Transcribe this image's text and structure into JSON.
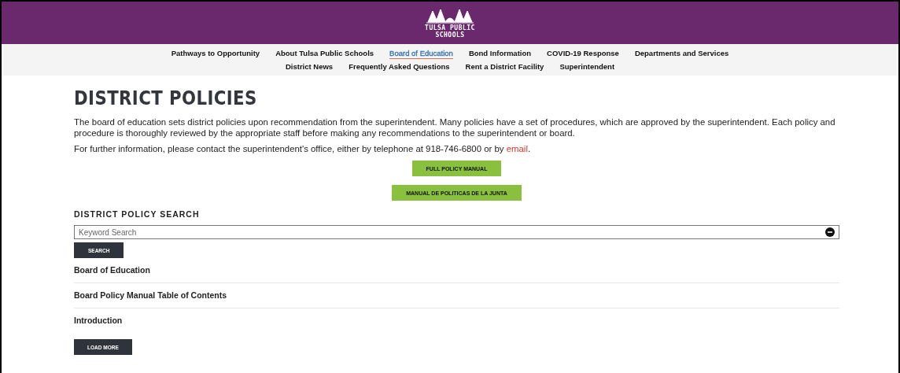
{
  "header": {
    "logo_lines": [
      "TULSA PUBLIC",
      "SCHOOLS"
    ]
  },
  "nav": {
    "items": [
      {
        "label": "Pathways to Opportunity",
        "selected": false
      },
      {
        "label": "About Tulsa Public Schools",
        "selected": false
      },
      {
        "label": "Board of Education",
        "selected": true
      },
      {
        "label": "Bond Information",
        "selected": false
      },
      {
        "label": "COVID-19 Response",
        "selected": false
      },
      {
        "label": "Departments and Services",
        "selected": false
      },
      {
        "label": "District News",
        "selected": false
      },
      {
        "label": "Frequently Asked Questions",
        "selected": false
      },
      {
        "label": "Rent a District Facility",
        "selected": false
      },
      {
        "label": "Superintendent",
        "selected": false
      }
    ]
  },
  "page_title": "DISTRICT POLICIES",
  "intro": "The board of education sets district policies upon recommendation from the superintendent. Many policies have a set of procedures, which are approved by the superintendent. Each policy and procedure is thoroughly reviewed by the appropriate staff before making any recommendations to the superintendent or board.",
  "contact": {
    "before": "For further information, please contact the superintendent's office, either by telephone at 918-746-6800 or by ",
    "link": "email",
    "after": "."
  },
  "buttons": [
    "FULL POLICY MANUAL",
    "MANUAL DE POLITICAS DE LA JUNTA"
  ],
  "search": {
    "heading": "DISTRICT POLICY SEARCH",
    "placeholder": "Keyword Search",
    "button": "SEARCH"
  },
  "results": [
    "Board of Education",
    "Board Policy Manual Table of Contents",
    "Introduction"
  ],
  "load_more": "LOAD MORE"
}
